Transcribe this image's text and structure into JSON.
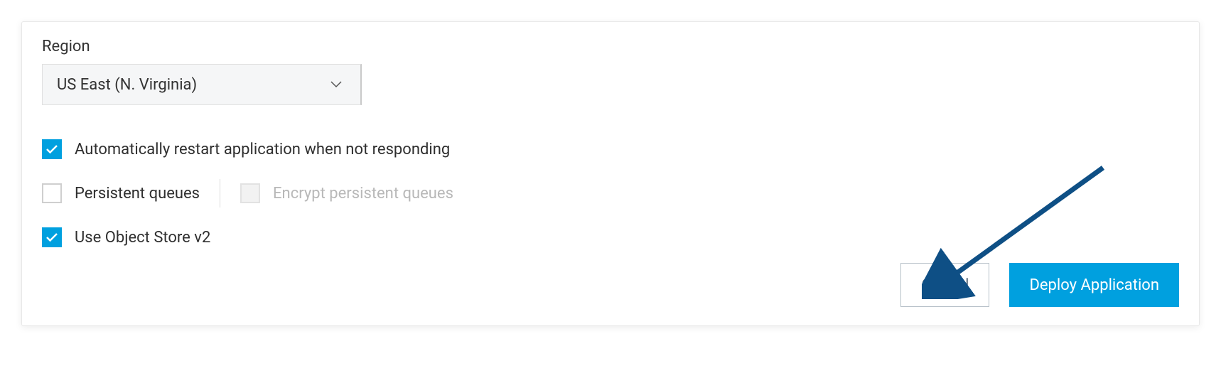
{
  "region": {
    "label": "Region",
    "selected": "US East (N. Virginia)"
  },
  "options": {
    "auto_restart": {
      "label": "Automatically restart application when not responding",
      "checked": true
    },
    "persistent_queues": {
      "label": "Persistent queues",
      "checked": false
    },
    "encrypt_persistent_queues": {
      "label": "Encrypt persistent queues",
      "checked": false,
      "disabled": true
    },
    "object_store_v2": {
      "label": "Use Object Store v2",
      "checked": true
    }
  },
  "buttons": {
    "cancel": "Cancel",
    "deploy": "Deploy Application"
  },
  "colors": {
    "accent": "#00a0df",
    "arrow": "#0e4f85"
  }
}
